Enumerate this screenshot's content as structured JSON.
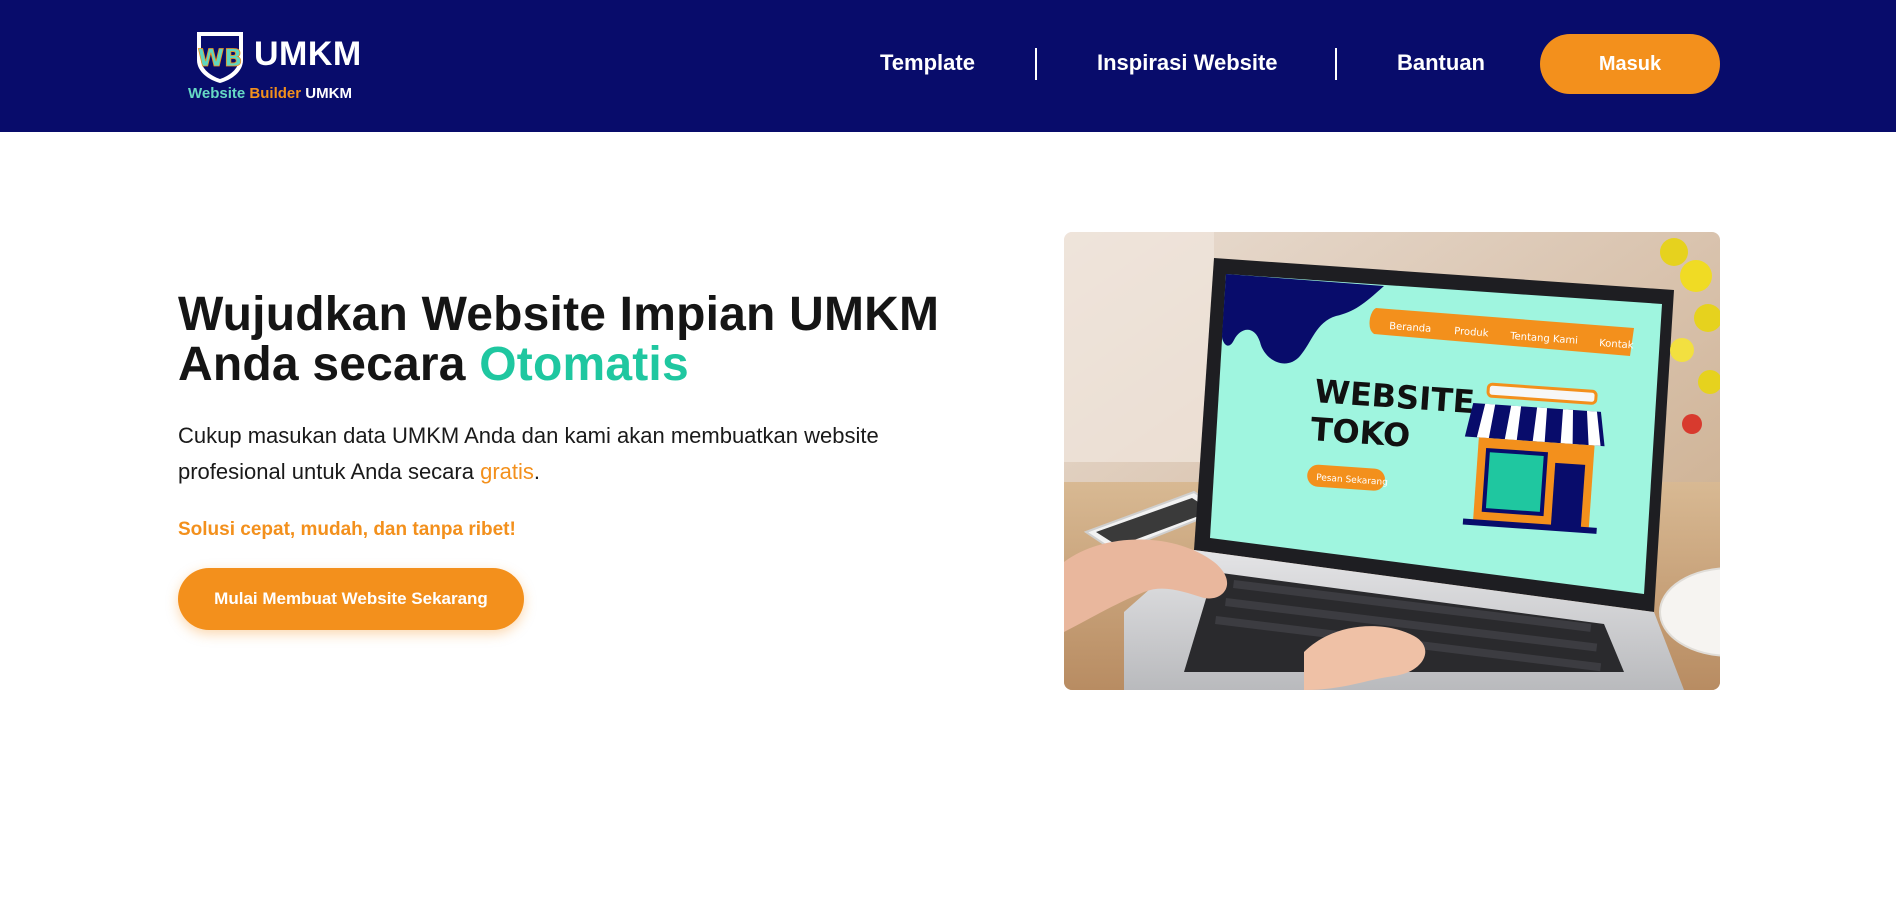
{
  "header": {
    "logo": {
      "badge_letters": "WB",
      "name": "UMKM",
      "tagline_1": "Website",
      "tagline_2": "Builder",
      "tagline_3": "UMKM"
    },
    "nav": {
      "template": "Template",
      "inspirasi": "Inspirasi Website",
      "bantuan": "Bantuan"
    },
    "login_label": "Masuk"
  },
  "hero": {
    "title_main": "Wujudkan Website Impian UMKM Anda secara ",
    "title_accent": "Otomatis",
    "description_main": "Cukup masukan data UMKM Anda dan kami akan membuatkan website profesional untuk Anda secara ",
    "description_accent": "gratis",
    "description_end": ".",
    "subtext": "Solusi cepat, mudah, dan tanpa ribet!",
    "cta_label": "Mulai Membuat Website Sekarang",
    "illustration": {
      "nav_items": [
        "Beranda",
        "Produk",
        "Tentang Kami",
        "Kontak"
      ],
      "headline_1": "WEBSITE",
      "headline_2": "TOKO",
      "button": "Pesan Sekarang"
    }
  },
  "colors": {
    "navbar": "#080c6b",
    "accent_orange": "#f3901c",
    "accent_green": "#1fc7a0",
    "screen_mint": "#9ff5df"
  }
}
